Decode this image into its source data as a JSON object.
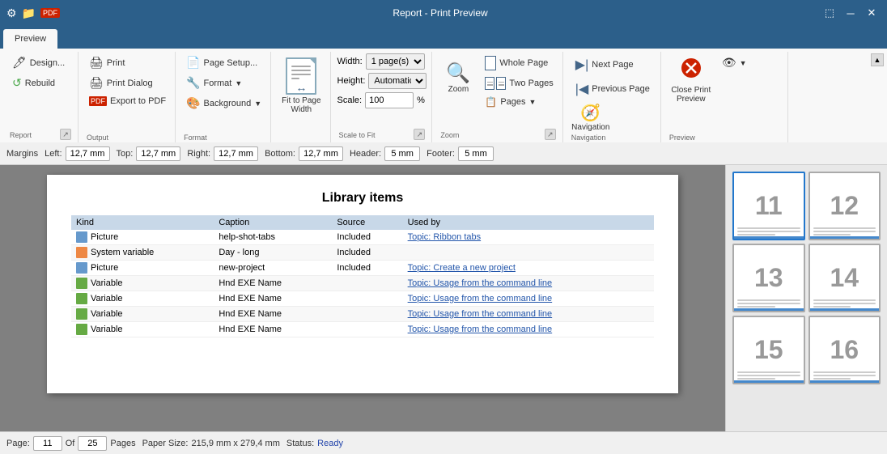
{
  "titlebar": {
    "title": "Report - Print Preview",
    "icons": [
      "settings-icon",
      "folder-icon",
      "pdf-icon"
    ]
  },
  "ribbon": {
    "active_tab": "Preview",
    "tabs": [
      "Preview"
    ],
    "groups": {
      "report": {
        "label": "Report",
        "buttons": [
          {
            "id": "design",
            "label": "Design..."
          },
          {
            "id": "rebuild",
            "label": "Rebuild"
          }
        ]
      },
      "output": {
        "label": "Output",
        "buttons": [
          {
            "id": "print",
            "label": "Print"
          },
          {
            "id": "print-dialog",
            "label": "Print Dialog"
          },
          {
            "id": "export-to-pdf",
            "label": "Export to PDF"
          }
        ]
      },
      "format": {
        "label": "Format",
        "buttons": [
          {
            "id": "page-setup",
            "label": "Page Setup..."
          },
          {
            "id": "format",
            "label": "Format"
          },
          {
            "id": "background",
            "label": "Background"
          }
        ]
      },
      "fit": {
        "label": "",
        "fit_label": "Fit to Page\nWidth"
      },
      "scale": {
        "label": "Scale to Fit",
        "width_label": "Width:",
        "width_value": "1 page(s)",
        "height_label": "Height:",
        "height_value": "Automatic",
        "scale_label": "Scale:",
        "scale_value": "100"
      },
      "zoom": {
        "label": "Zoom",
        "whole_page": "Whole Page",
        "two_pages": "Two Pages",
        "pages": "Pages",
        "zoom_label": "Zoom"
      },
      "navigation": {
        "label": "Navigation",
        "next_page": "Next Page",
        "previous_page": "Previous Page",
        "navigation": "Navigation"
      },
      "preview": {
        "label": "Preview",
        "close_preview": "Close Print\nPreview",
        "eye_label": "▼"
      }
    }
  },
  "margins": {
    "label": "Margins",
    "left_label": "Left:",
    "left_value": "12,7 mm",
    "top_label": "Top:",
    "top_value": "12,7 mm",
    "right_label": "Right:",
    "right_value": "12,7 mm",
    "bottom_label": "Bottom:",
    "bottom_value": "12,7 mm",
    "header_label": "Header:",
    "header_value": "5 mm",
    "footer_label": "Footer:",
    "footer_value": "5 mm"
  },
  "table": {
    "title": "Library items",
    "headers": [
      "Kind",
      "Caption",
      "Source",
      "Used by"
    ],
    "rows": [
      {
        "kind": "Picture",
        "kind_type": "picture",
        "caption": "help-shot-tabs",
        "source": "Included",
        "used_by": "Topic: Ribbon tabs"
      },
      {
        "kind": "System variable",
        "kind_type": "sysvar",
        "caption": "Day - long",
        "source": "Included",
        "used_by": ""
      },
      {
        "kind": "Picture",
        "kind_type": "picture",
        "caption": "new-project",
        "source": "Included",
        "used_by": "Topic: Create a new project"
      },
      {
        "kind": "Variable",
        "kind_type": "variable",
        "caption": "Hnd EXE Name",
        "source": "",
        "used_by": "Topic: Usage from the command line"
      },
      {
        "kind": "Variable",
        "kind_type": "variable",
        "caption": "Hnd EXE Name",
        "source": "",
        "used_by": "Topic: Usage from the command line"
      },
      {
        "kind": "Variable",
        "kind_type": "variable",
        "caption": "Hnd EXE Name",
        "source": "",
        "used_by": "Topic: Usage from the command line"
      },
      {
        "kind": "Variable",
        "kind_type": "variable",
        "caption": "Hnd EXE Name",
        "source": "",
        "used_by": "Topic: Usage from the command line"
      }
    ]
  },
  "thumbnails": [
    {
      "number": "11",
      "active": true
    },
    {
      "number": "12",
      "active": false
    },
    {
      "number": "13",
      "active": false
    },
    {
      "number": "14",
      "active": false
    },
    {
      "number": "15",
      "active": false
    },
    {
      "number": "16",
      "active": false
    }
  ],
  "statusbar": {
    "page_label": "Page:",
    "page_value": "11",
    "of_label": "Of",
    "total_pages": "25",
    "pages_label": "Pages",
    "paper_size_label": "Paper Size:",
    "paper_size_value": "215,9 mm x 279,4 mm",
    "status_label": "Status:",
    "status_value": "Ready"
  }
}
